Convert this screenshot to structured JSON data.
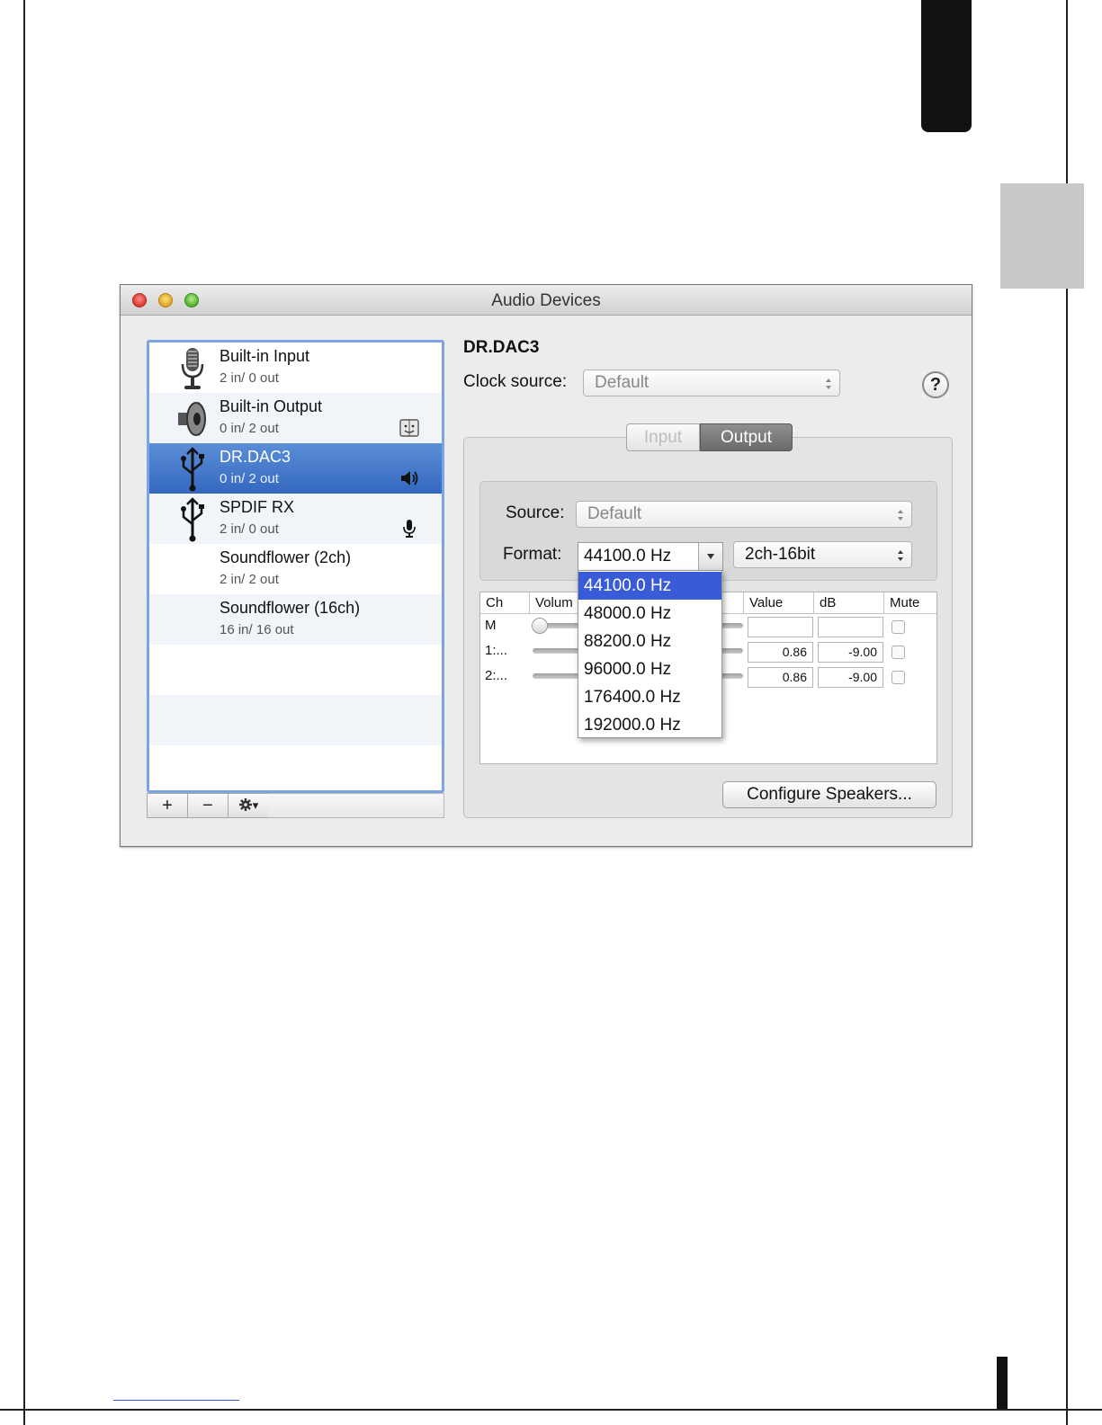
{
  "window": {
    "title": "Audio Devices"
  },
  "devices": [
    {
      "name": "Built-in Input",
      "io": "2 in/ 0 out",
      "icon": "microphone-icon"
    },
    {
      "name": "Built-in Output",
      "io": "0 in/ 2 out",
      "icon": "speaker-icon",
      "badge": "finder-icon"
    },
    {
      "name": "DR.DAC3",
      "io": "0 in/ 2 out",
      "icon": "usb-icon",
      "badge": "speaker-volume-icon",
      "selected": true
    },
    {
      "name": "SPDIF RX",
      "io": "2 in/ 0 out",
      "icon": "usb-icon",
      "badge": "microphone-small-icon"
    },
    {
      "name": "Soundflower (2ch)",
      "io": "2 in/ 2 out"
    },
    {
      "name": "Soundflower (16ch)",
      "io": "16 in/ 16 out"
    }
  ],
  "list_buttons": {
    "add": "+",
    "remove": "−",
    "gear_arrow": "▾"
  },
  "detail": {
    "device_title": "DR.DAC3",
    "clock_label": "Clock source:",
    "clock_value": "Default",
    "help": "?",
    "tabs": {
      "input": "Input",
      "output": "Output",
      "selected": "Output"
    },
    "source_label": "Source:",
    "source_value": "Default",
    "format_label": "Format:",
    "format_value": "44100.0 Hz",
    "format_bits": "2ch-16bit"
  },
  "table": {
    "headers": {
      "ch": "Ch",
      "volume": "Volum",
      "value": "Value",
      "db": "dB",
      "mute": "Mute"
    },
    "rows": [
      {
        "ch": "M",
        "value": "",
        "db": ""
      },
      {
        "ch": "1:...",
        "value": "0.86",
        "db": "-9.00"
      },
      {
        "ch": "2:...",
        "value": "0.86",
        "db": "-9.00"
      }
    ]
  },
  "format_menu": {
    "items": [
      "44100.0 Hz",
      "48000.0 Hz",
      "88200.0 Hz",
      "96000.0 Hz",
      "176400.0 Hz",
      "192000.0 Hz"
    ],
    "selected_index": 0
  },
  "configure_button": "Configure Speakers...",
  "colors": {
    "selection_blue": "#3a5bd8",
    "list_selection": "#3468bf",
    "list_border": "#7aa4e6"
  }
}
